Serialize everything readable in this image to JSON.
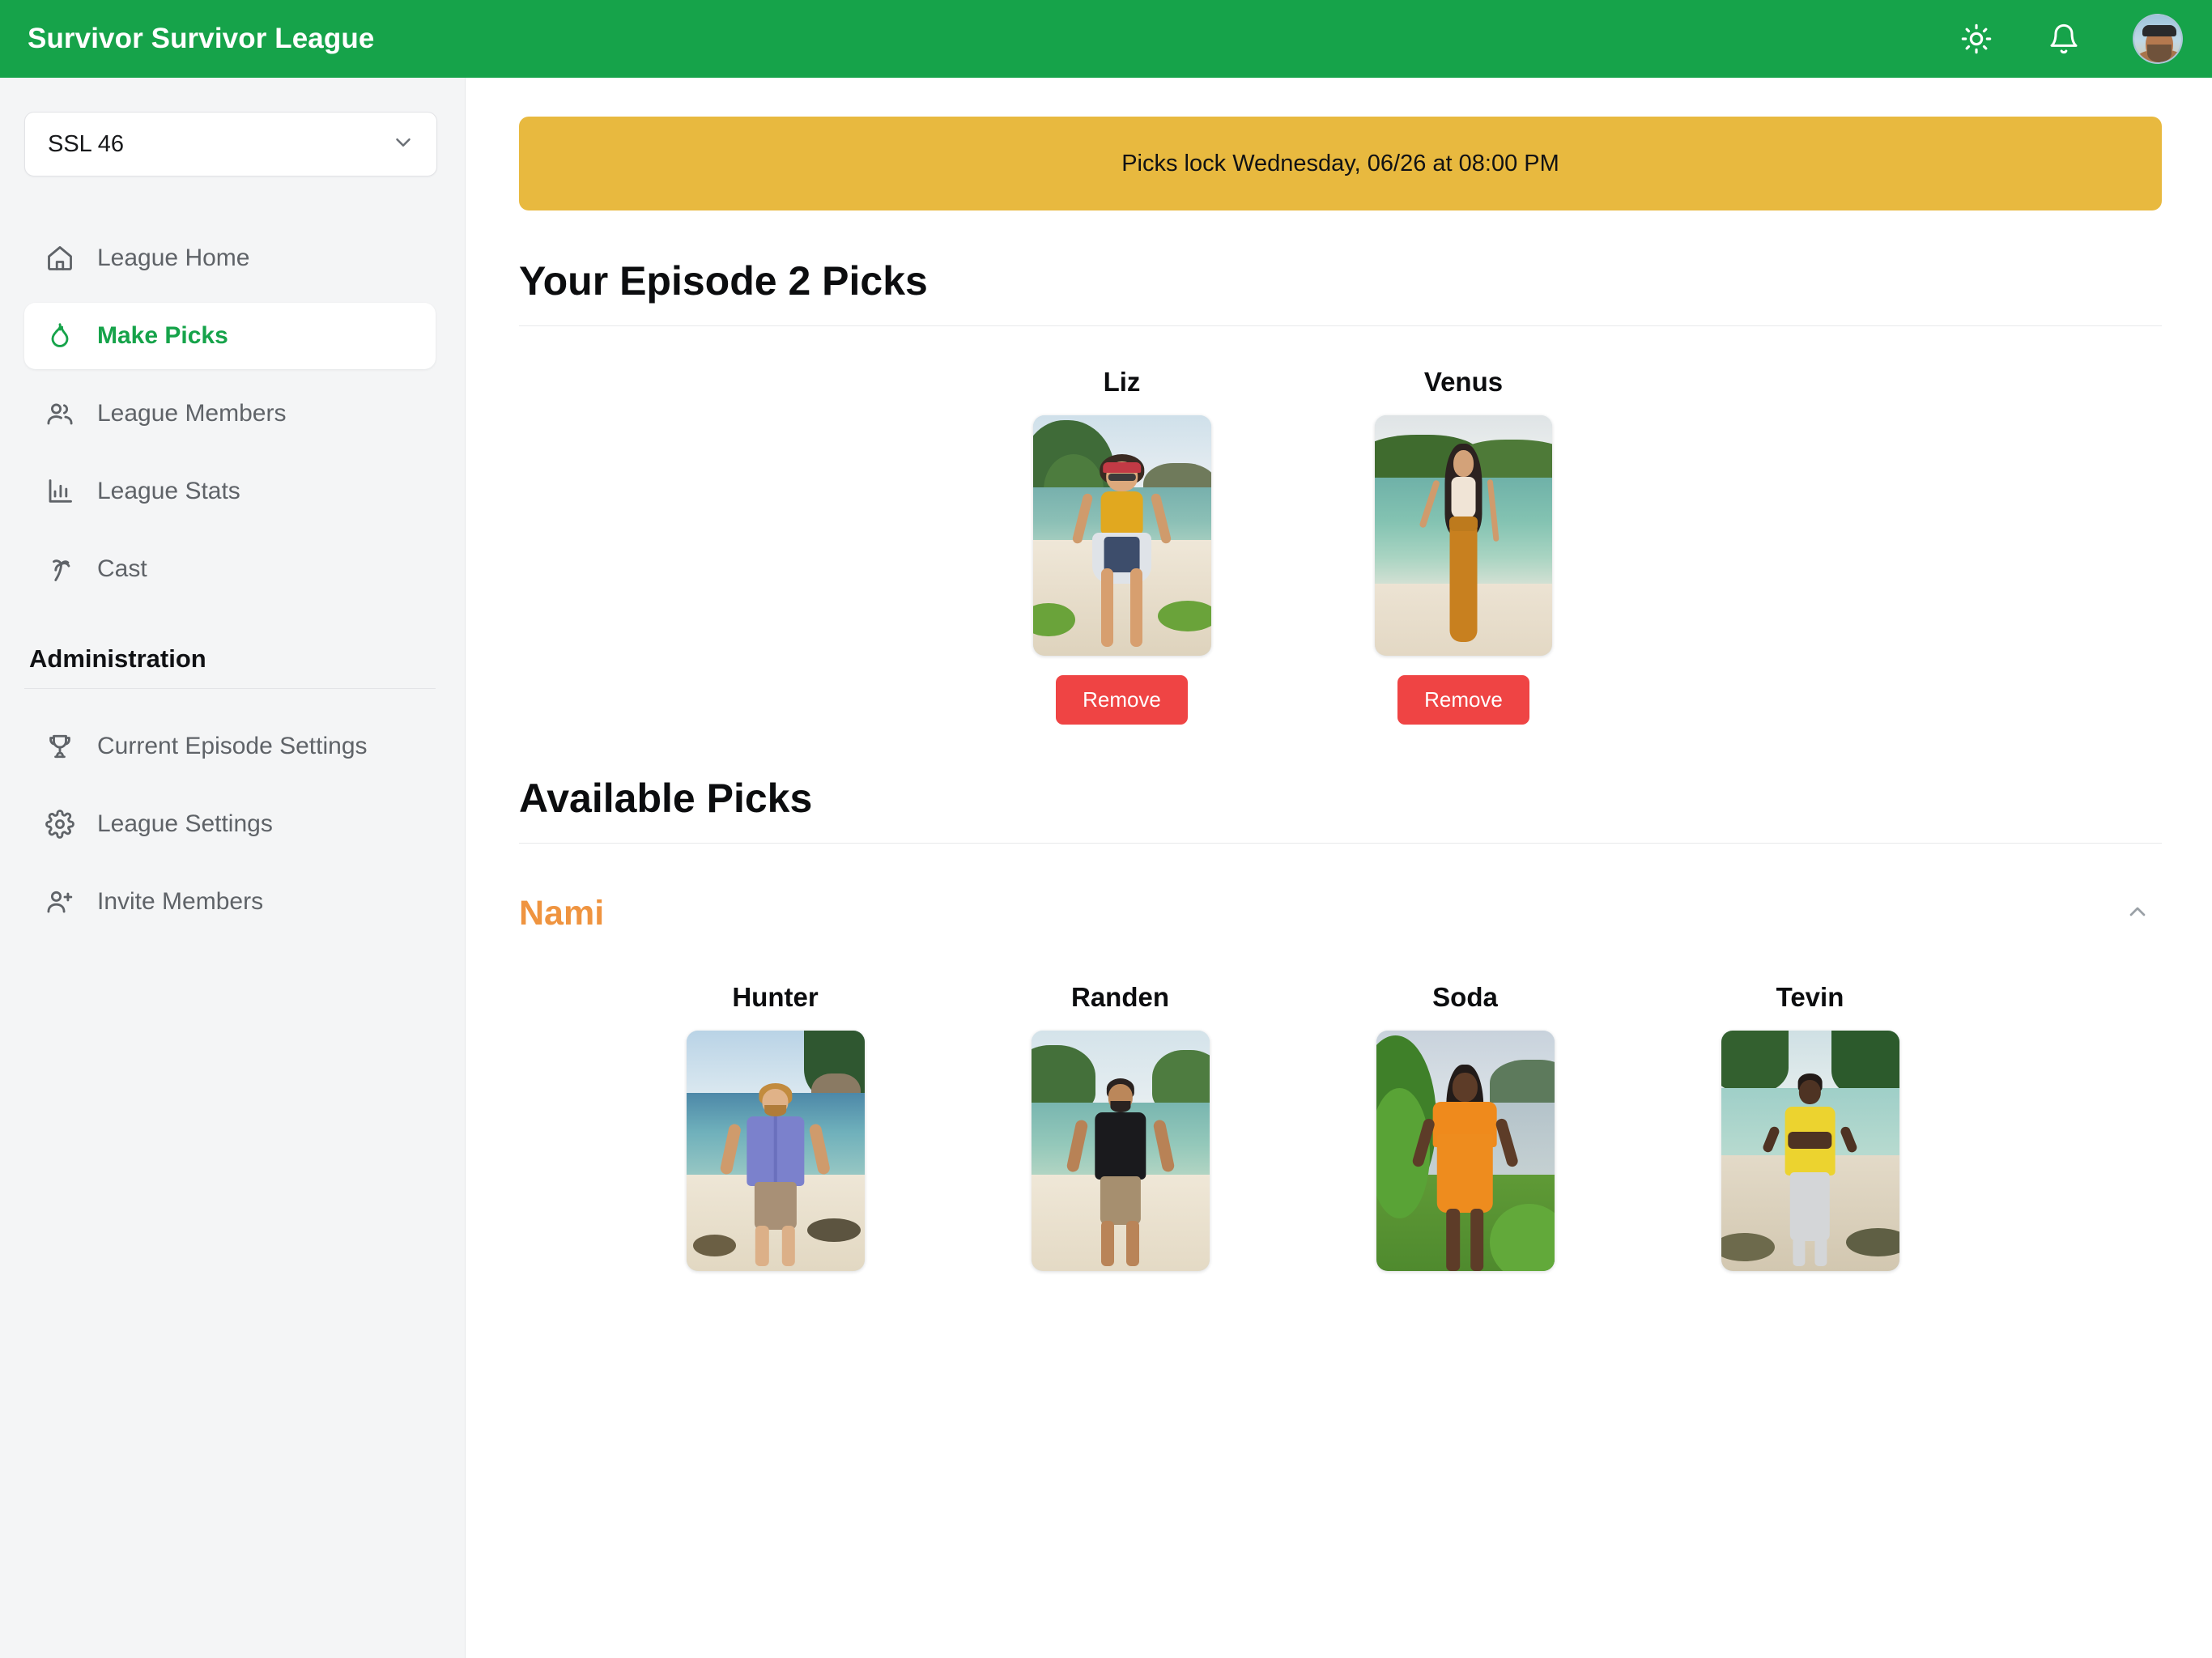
{
  "app": {
    "brand": "Survivor Survivor League",
    "theme_color": "#16a34a",
    "accent_orange": "#ef9440",
    "danger_color": "#ef4444",
    "banner_color": "#e8b93f"
  },
  "topbar": {
    "theme_toggle_icon": "sun-icon",
    "notifications_icon": "bell-icon",
    "avatar_icon": "user-avatar"
  },
  "sidebar": {
    "league_selector": {
      "value": "SSL 46",
      "chevron_icon": "chevron-down-icon"
    },
    "nav": [
      {
        "label": "League Home",
        "icon": "home-icon",
        "active": false
      },
      {
        "label": "Make Picks",
        "icon": "flame-icon",
        "active": true
      },
      {
        "label": "League Members",
        "icon": "users-icon",
        "active": false
      },
      {
        "label": "League Stats",
        "icon": "bar-chart-icon",
        "active": false
      },
      {
        "label": "Cast",
        "icon": "palm-tree-icon",
        "active": false
      }
    ],
    "admin_title": "Administration",
    "admin_nav": [
      {
        "label": "Current Episode Settings",
        "icon": "trophy-icon"
      },
      {
        "label": "League Settings",
        "icon": "gear-icon"
      },
      {
        "label": "Invite Members",
        "icon": "user-plus-icon"
      }
    ]
  },
  "main": {
    "lock_banner": "Picks lock Wednesday, 06/26 at 08:00 PM",
    "your_picks_heading": "Your Episode 2 Picks",
    "your_picks": [
      {
        "name": "Liz",
        "remove_label": "Remove"
      },
      {
        "name": "Venus",
        "remove_label": "Remove"
      }
    ],
    "available_heading": "Available Picks",
    "tribes": [
      {
        "name": "Nami",
        "collapse_icon": "chevron-up-icon",
        "expanded": true,
        "contestants": [
          {
            "name": "Hunter"
          },
          {
            "name": "Randen"
          },
          {
            "name": "Soda"
          },
          {
            "name": "Tevin"
          }
        ]
      }
    ]
  }
}
